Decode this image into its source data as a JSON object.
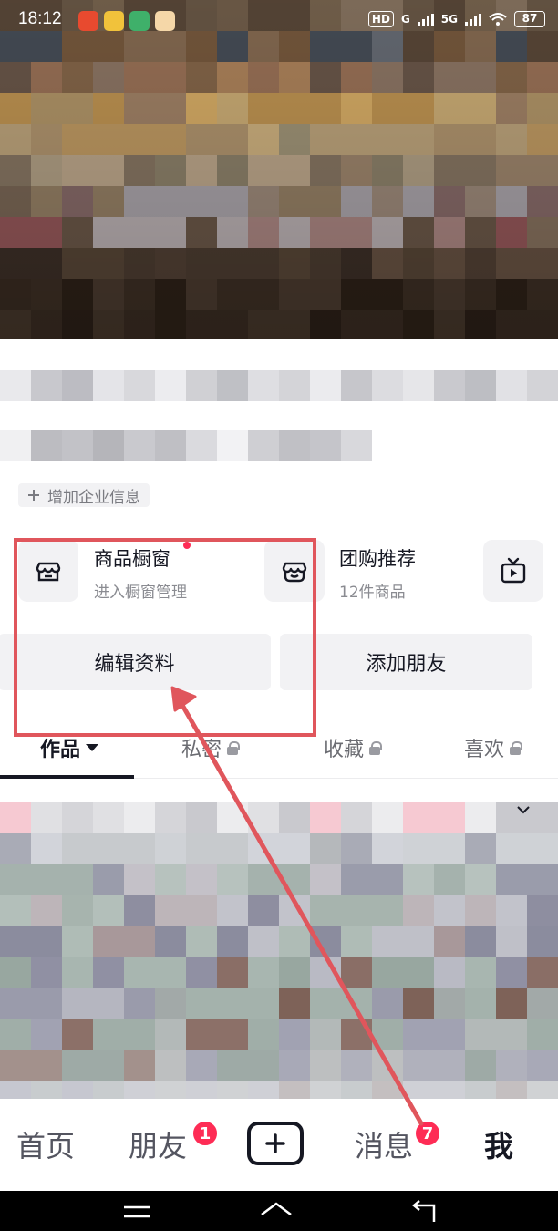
{
  "status_bar": {
    "time": "18:12",
    "network_labels": [
      "HD",
      "G",
      "5G"
    ],
    "battery": "87"
  },
  "profile": {
    "add_enterprise_label": "增加企业信息",
    "add_icon": "plus-icon"
  },
  "services": [
    {
      "title": "商品橱窗",
      "subtitle": "进入橱窗管理",
      "icon": "storefront-icon",
      "has_dot": true
    },
    {
      "title": "团购推荐",
      "subtitle": "12件商品",
      "icon": "shop-basket-icon",
      "has_dot": false
    },
    {
      "icon": "tv-play-icon"
    }
  ],
  "buttons": {
    "edit_profile": "编辑资料",
    "add_friends": "添加朋友"
  },
  "tabs": [
    {
      "label": "作品",
      "active": true,
      "suffix_icon": "caret-down-icon"
    },
    {
      "label": "私密",
      "active": false,
      "suffix_icon": "lock-icon"
    },
    {
      "label": "收藏",
      "active": false,
      "suffix_icon": "lock-icon"
    },
    {
      "label": "喜欢",
      "active": false,
      "suffix_icon": "lock-icon"
    }
  ],
  "bottom_nav": {
    "home": "首页",
    "friends": "朋友",
    "friends_badge": "1",
    "messages": "消息",
    "messages_badge": "7",
    "me": "我"
  },
  "colors": {
    "annotation_red": "#e0565c",
    "badge_red": "#fe2c55",
    "button_bg": "#f2f2f4",
    "text_dark": "#161823"
  }
}
